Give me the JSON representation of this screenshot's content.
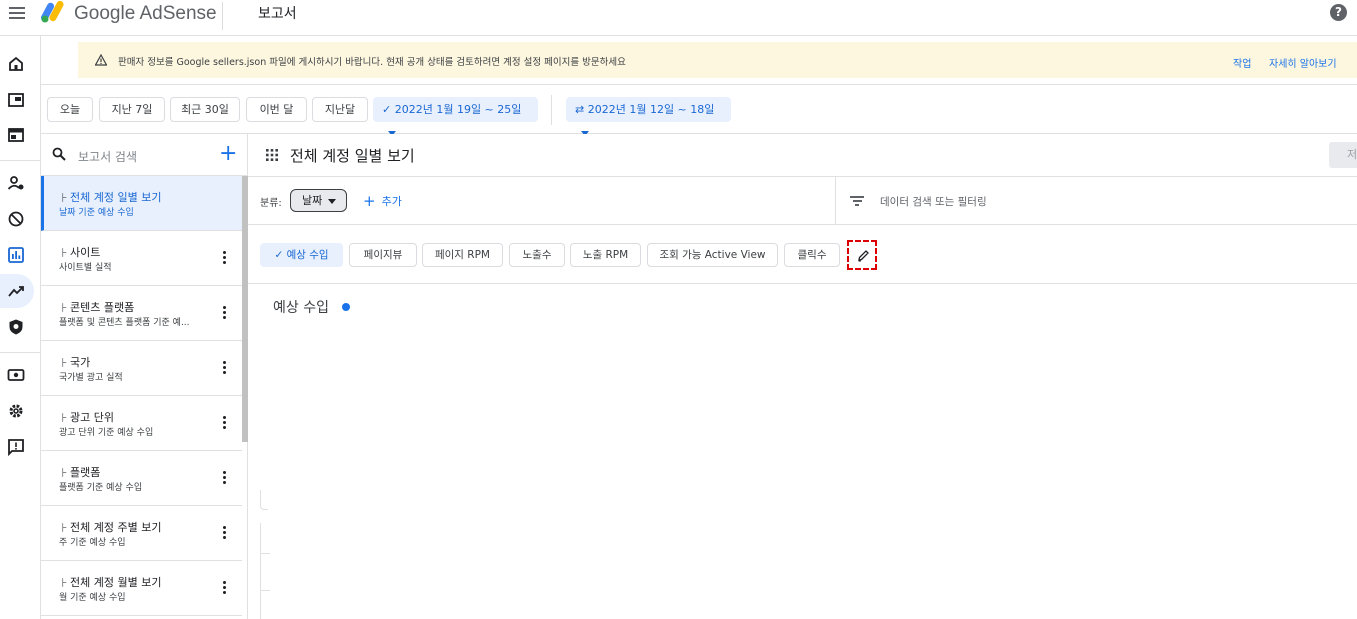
{
  "header": {
    "brand": "Google AdSense",
    "page_name": "보고서",
    "help_icon": "help-icon"
  },
  "rail": {
    "icons": [
      "home-icon",
      "ads-icon",
      "sites-icon",
      "account-icon",
      "block-icon",
      "reports-icon",
      "optimization-icon",
      "privacy-icon",
      "payments-icon",
      "settings-icon",
      "feedback-icon"
    ],
    "active": "reports-icon"
  },
  "banner": {
    "text": "판매자 정보를 Google sellers.json 파일에 게시하시기 바랍니다. 현재 공개 상태를 검토하려면 계정 설정 페이지를 방문하세요",
    "action_label": "작업",
    "learn_more_label": "자세히 알아보기"
  },
  "date_bar": {
    "presets": [
      "오늘",
      "지난 7일",
      "최근 30일",
      "이번 달",
      "지난달"
    ],
    "range": "2022년 1월 19일 ~ 25일",
    "compare_range": "2022년 1월 12일 ~ 18일"
  },
  "reports_panel": {
    "search_placeholder": "보고서 검색",
    "items": [
      {
        "title": "전체 계정 일별 보기",
        "subtitle": "날짜 기준 예상 수입"
      },
      {
        "title": "사이트",
        "subtitle": "사이트별 실적"
      },
      {
        "title": "콘텐츠 플랫폼",
        "subtitle": "플랫폼 및 콘텐츠 플랫폼 기준 예..."
      },
      {
        "title": "국가",
        "subtitle": "국가별 광고 실적"
      },
      {
        "title": "광고 단위",
        "subtitle": "광고 단위 기준 예상 수입"
      },
      {
        "title": "플랫폼",
        "subtitle": "플랫폼 기준 예상 수입"
      },
      {
        "title": "전체 계정 주별 보기",
        "subtitle": "주 기준 예상 수입"
      },
      {
        "title": "전체 계정 월별 보기",
        "subtitle": "월 기준 예상 수입"
      }
    ]
  },
  "report": {
    "title": "전체 계정 일별 보기",
    "save_label": "저",
    "breakdown_label": "분류:",
    "breakdown_value": "날짜",
    "add_label": "추가",
    "filter_placeholder": "데이터 검색 또는 필터링",
    "metrics": [
      "예상 수입",
      "페이지뷰",
      "페이지 RPM",
      "노출수",
      "노출 RPM",
      "조회 가능 Active View",
      "클릭수"
    ],
    "selected_metric": "예상 수입",
    "chart_title": "예상 수입",
    "series_color": "#1a73e8"
  },
  "colors": {
    "accent": "#1a73e8",
    "banner_bg": "#fef7e0",
    "selected_bg": "#e8f0fe"
  }
}
